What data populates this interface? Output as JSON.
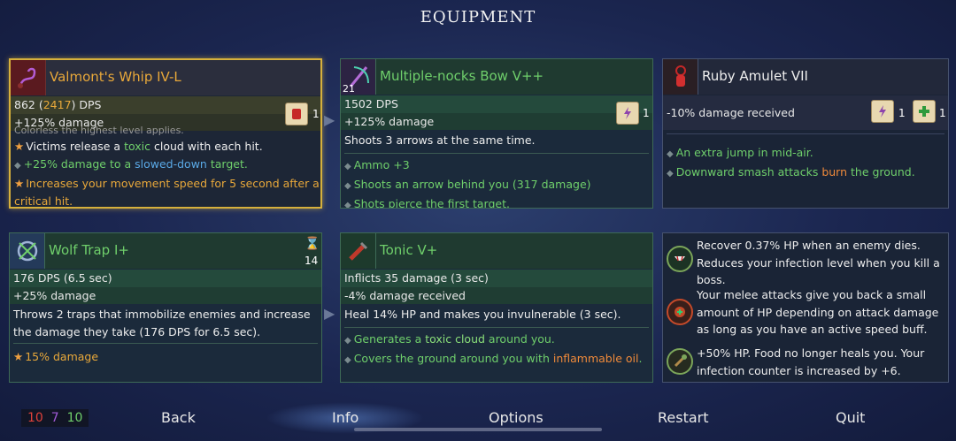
{
  "title": "EQUIPMENT",
  "cards": {
    "whip": {
      "icon": "whip-icon",
      "name": "Valmont's Whip IV-L",
      "dps_prefix": "862 (",
      "dps_highlight": "2417",
      "dps_suffix": ") DPS",
      "damage": "+125% damage",
      "scroll_count": "1",
      "partial_top": "Colorless the highest level applies.",
      "line1_pre": "Victims release a ",
      "line1_hl": "toxic",
      "line1_post": " cloud with each hit.",
      "line2_pre": "+25% damage to a ",
      "line2_hl": "slowed-down",
      "line2_post": " target.",
      "line3": "Increases your movement speed for 5 second after a",
      "line3b": "critical hit."
    },
    "bow": {
      "icon": "bow-icon",
      "level": "21",
      "name": "Multiple-nocks Bow V++",
      "dps": "1502 DPS",
      "damage": "+125% damage",
      "scroll_count": "1",
      "desc": "Shoots 3 arrows at the same time.",
      "bullets": [
        "Ammo +3",
        "Shoots an arrow behind you (317 damage)",
        "Shots pierce the first target."
      ]
    },
    "amulet": {
      "icon": "amulet-icon",
      "name": "Ruby Amulet VII",
      "stat": "-10% damage received",
      "scroll1_count": "1",
      "scroll2_count": "1",
      "bullet1": "An extra jump in mid-air.",
      "bullet2_pre": "Downward smash attacks ",
      "bullet2_hl": "burn",
      "bullet2_post": " the ground."
    },
    "trap": {
      "icon": "wolf-trap-icon",
      "name": "Wolf Trap I+",
      "cooldown": "14",
      "dps": "176 DPS (6.5 sec)",
      "damage": "+25% damage",
      "desc": "Throws 2 traps that immobilize enemies and increase the damage they take (176 DPS for 6.5 sec).",
      "bullet": "15% damage"
    },
    "tonic": {
      "icon": "tonic-icon",
      "name": "Tonic V+",
      "stat1": "Inflicts 35 damage (3 sec)",
      "stat2": "-4% damage received",
      "desc": "Heal 14% HP and makes you invulnerable (3 sec).",
      "bullet1_pre": "Generates a ",
      "bullet1_hl": "toxic cloud",
      "bullet1_post": " around you.",
      "bullet2_pre": "Covers the ground around you with ",
      "bullet2_hl": "inflammable oil",
      "bullet2_post": "."
    }
  },
  "mutations": [
    {
      "icon": "vampire-mutation-icon",
      "text": "Recover 0.37% HP when an enemy dies. Reduces your infection level when you kill a boss."
    },
    {
      "icon": "melee-heal-mutation-icon",
      "text": "Your melee attacks give you back a small amount of HP depending on attack damage as long as you have an active speed buff."
    },
    {
      "icon": "food-mutation-icon",
      "text": "+50% HP. Food no longer heals you. Your infection counter is increased by +6."
    }
  ],
  "footer": {
    "stat_red": "10",
    "stat_purple": "7",
    "stat_green": "10",
    "back": "Back",
    "info": "Info",
    "options": "Options",
    "restart": "Restart",
    "quit": "Quit"
  },
  "colors": {
    "red": "#e0413a",
    "purple": "#a25ad8",
    "green": "#6fcf6b",
    "gold": "#e8a83a"
  }
}
